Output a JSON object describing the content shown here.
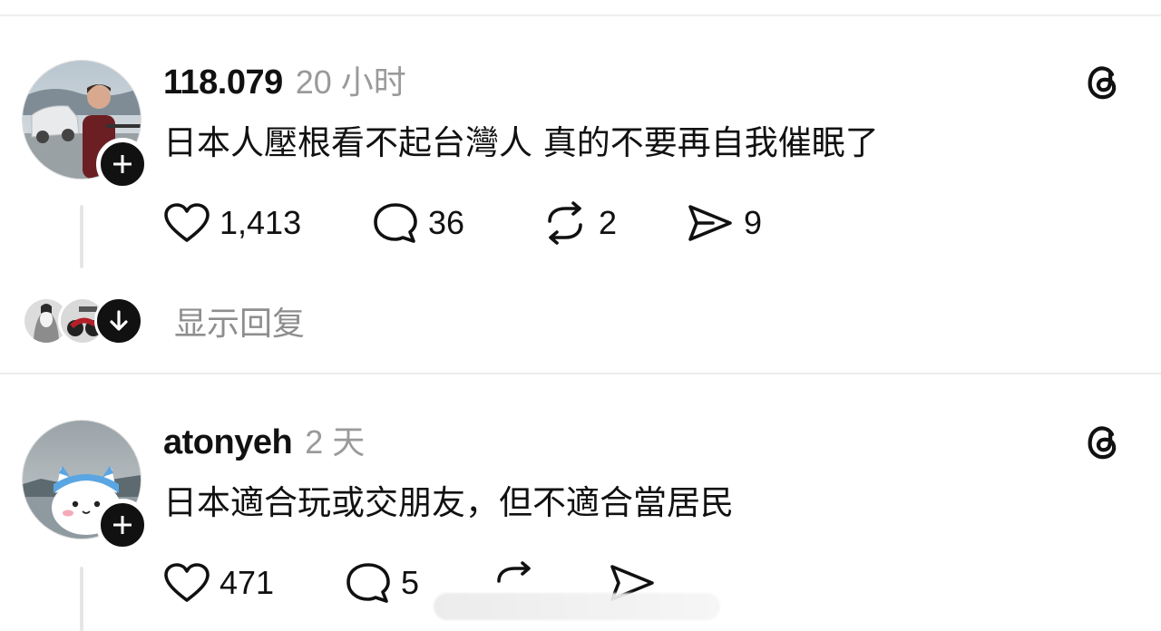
{
  "posts": [
    {
      "username": "118.079",
      "time": "20 小时",
      "content": "日本人壓根看不起台灣人 真的不要再自我催眠了",
      "stats": {
        "likes": "1,413",
        "comments": "36",
        "reposts": "2",
        "shares": "9"
      },
      "replies_label": "显示回复",
      "avatar_icon": "man-with-car-avatar"
    },
    {
      "username": "atonyeh",
      "time": "2 天",
      "content": "日本適合玩或交朋友，但不適合當居民",
      "stats": {
        "likes": "471",
        "comments": "5"
      },
      "avatar_icon": "chiikawa-cat-avatar"
    }
  ],
  "icons": {
    "like": "heart-icon",
    "comment": "comment-icon",
    "repost": "repost-icon",
    "share": "send-icon",
    "brand": "threads-logo-icon",
    "follow": "plus-icon",
    "expand": "arrow-down-icon"
  },
  "colors": {
    "text": "#111111",
    "muted": "#9a9a9a",
    "divider": "#ececec"
  }
}
